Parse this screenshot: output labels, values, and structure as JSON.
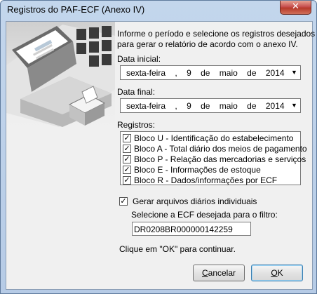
{
  "window": {
    "title": "Registros do PAF-ECF (Anexo IV)",
    "close_glyph": "✕"
  },
  "intro": {
    "line1": "Informe o período e selecione os registros desejados",
    "line2": "para gerar o relatório de acordo com o anexo IV."
  },
  "data_inicial": {
    "label": "Data inicial:",
    "weekday": "sexta-feira",
    "sep": ",",
    "day": "9",
    "de1": "de",
    "month": "maio",
    "de2": "de",
    "year": "2014"
  },
  "data_final": {
    "label": "Data final:",
    "weekday": "sexta-feira",
    "sep": ",",
    "day": "9",
    "de1": "de",
    "month": "maio",
    "de2": "de",
    "year": "2014"
  },
  "registros": {
    "label": "Registros:",
    "items": [
      {
        "label": "Bloco U - Identificação do estabelecimento",
        "checked": true
      },
      {
        "label": "Bloco A - Total diário dos meios de pagamento",
        "checked": true
      },
      {
        "label": "Bloco P - Relação das mercadorias e serviços",
        "checked": true
      },
      {
        "label": "Bloco E - Informações de estoque",
        "checked": true
      },
      {
        "label": "Bloco R - Dados/informações por ECF",
        "checked": true
      }
    ]
  },
  "gerar_diarios": {
    "label": "Gerar arquivos diários individuais",
    "checked": true
  },
  "ecf": {
    "label": "Selecione a ECF desejada para o filtro:",
    "value": "DR0208BR000000142259"
  },
  "hint": "Clique em \"OK\" para continuar.",
  "buttons": {
    "cancel_first": "C",
    "cancel_rest": "ancelar",
    "ok_first": "O",
    "ok_rest": "K"
  },
  "check_glyph": "✓",
  "dropdown_glyph": "▼"
}
